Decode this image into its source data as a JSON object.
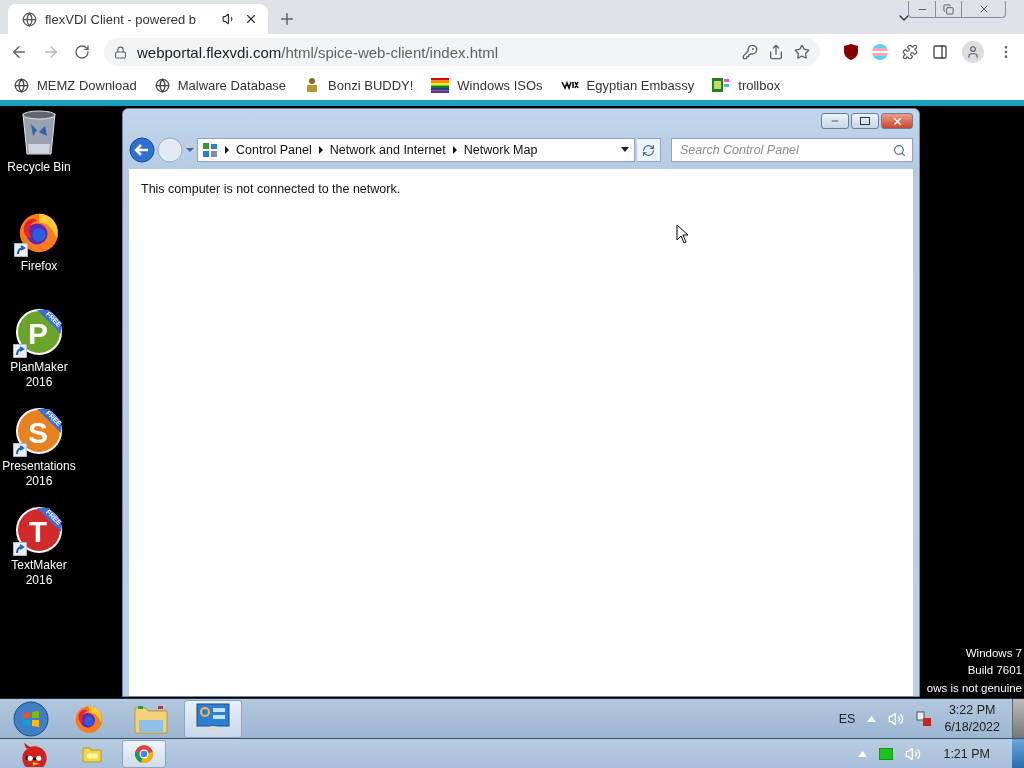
{
  "browser": {
    "tabs": [
      {
        "title": "flexVDI Client - powered b",
        "audio": true,
        "selected": true
      }
    ],
    "url_host": "webportal.flexvdi.com",
    "url_path": "/html/spice-web-client/index.html",
    "bookmarks": [
      {
        "label": "MEMZ Download",
        "kind": "globe"
      },
      {
        "label": "Malware Database",
        "kind": "globe"
      },
      {
        "label": "Bonzi BUDDY!",
        "kind": "bonzi"
      },
      {
        "label": "Windows ISOs",
        "kind": "rainbow"
      },
      {
        "label": "Egyptian Embassy",
        "kind": "wix"
      },
      {
        "label": "trollbox",
        "kind": "troll"
      }
    ]
  },
  "desktop": {
    "icons": [
      {
        "label": "Recycle Bin",
        "kind": "bin",
        "shortcut": false
      },
      {
        "label": "Firefox",
        "kind": "firefox",
        "shortcut": true
      },
      {
        "label": "PlanMaker 2016",
        "kind": "app",
        "letter": "P",
        "ribbon": "FREE",
        "color": "#6aa52a",
        "shortcut": true
      },
      {
        "label": "Presentations 2016",
        "kind": "app",
        "letter": "S",
        "ribbon": "FREE",
        "color": "#e8821e",
        "shortcut": true
      },
      {
        "label": "TextMaker 2016",
        "kind": "app",
        "letter": "T",
        "ribbon": "FREE",
        "color": "#d22a2a",
        "shortcut": true
      }
    ],
    "notice": [
      "Windows 7",
      "Build 7601",
      "ows is not genuine"
    ]
  },
  "window": {
    "breadcrumb": [
      "Control Panel",
      "Network and Internet",
      "Network Map"
    ],
    "search": {
      "placeholder": "Search Control Panel"
    },
    "message": "This computer is not connected to the network."
  },
  "taskbar": {
    "items": [
      {
        "kind": "start",
        "selected": false
      },
      {
        "kind": "firefox",
        "selected": false
      },
      {
        "kind": "explorer",
        "selected": false
      },
      {
        "kind": "control-panel",
        "selected": true
      }
    ],
    "language": "ES",
    "time": "3:22 PM",
    "date": "6/18/2022"
  },
  "host_taskbar": {
    "items": [
      {
        "kind": "bird",
        "selected": false
      },
      {
        "kind": "folder",
        "selected": false
      },
      {
        "kind": "chrome",
        "selected": true
      }
    ],
    "time": "1:21 PM"
  }
}
